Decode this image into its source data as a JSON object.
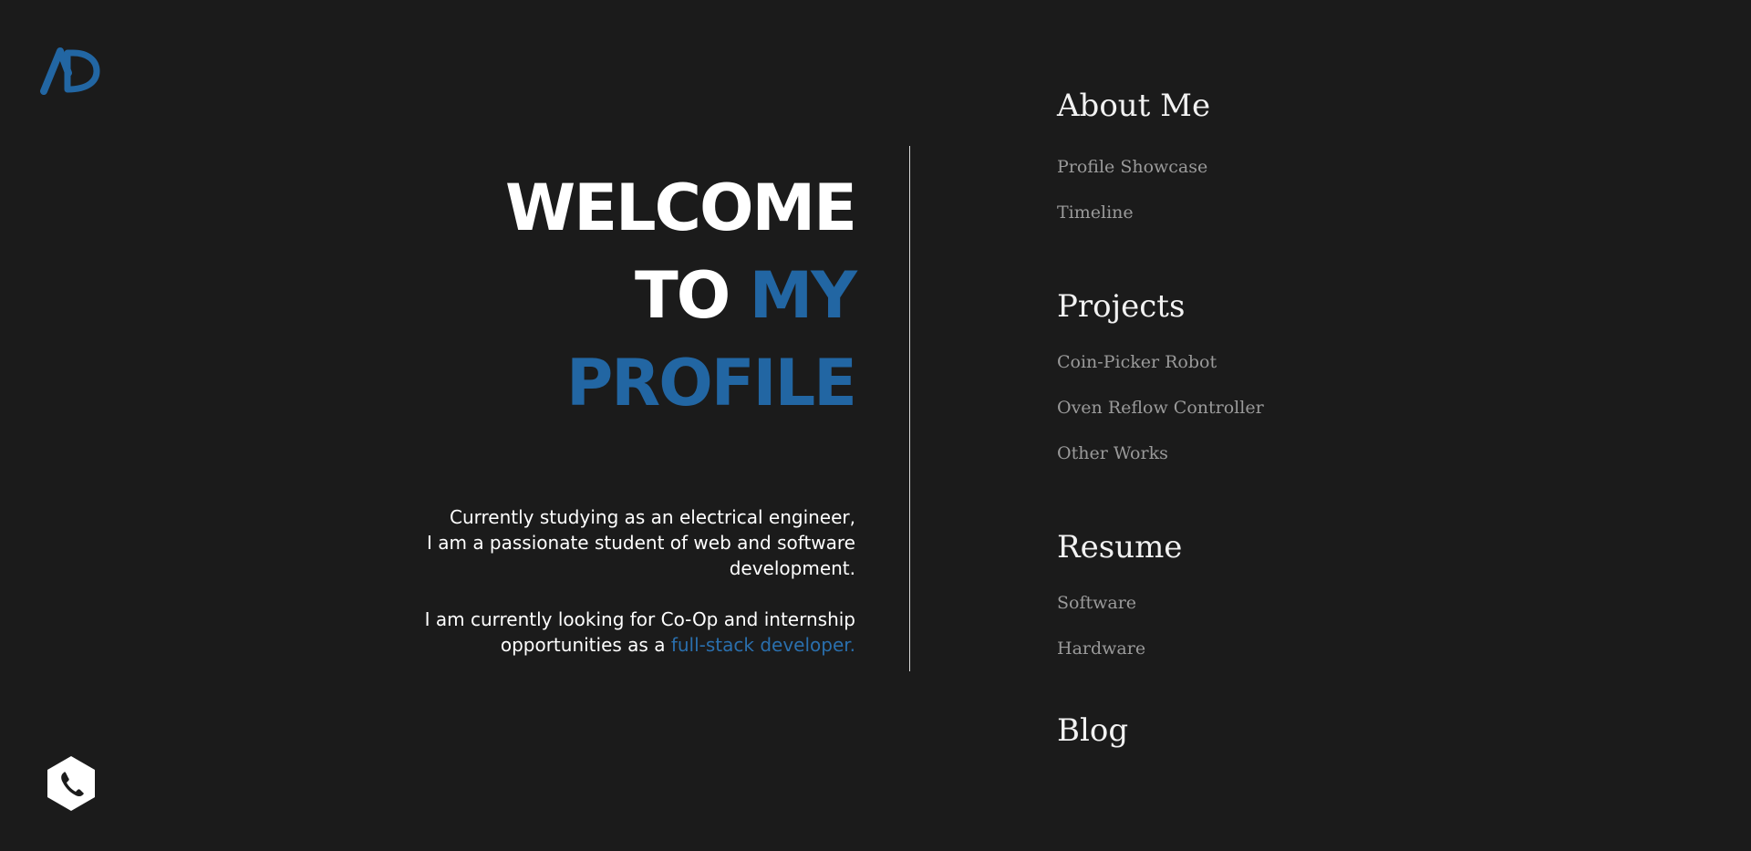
{
  "brand": {
    "logo_text": "AD",
    "logo_color": "#2266a3"
  },
  "hero": {
    "title_line1": "WELCOME",
    "title_line2_prefix": "TO ",
    "title_line2_accent": "MY",
    "title_line3": "PROFILE",
    "accent_color": "#2266a3"
  },
  "intro": {
    "line1": "Currently studying as an electrical engineer,",
    "line2": "I am a passionate student of web and software",
    "line3": "development.",
    "line4": "I am currently looking for Co-Op and internship",
    "line5_prefix": "opportunities as a ",
    "line5_link": "full-stack developer."
  },
  "nav": {
    "about": {
      "heading": "About Me",
      "items": [
        "Profile Showcase",
        "Timeline"
      ]
    },
    "projects": {
      "heading": "Projects",
      "items": [
        "Coin-Picker Robot",
        "Oven Reflow Controller",
        "Other Works"
      ]
    },
    "resume": {
      "heading": "Resume",
      "items": [
        "Software",
        "Hardware"
      ]
    },
    "blog": {
      "heading": "Blog"
    }
  },
  "contact": {
    "icon": "phone-icon"
  }
}
